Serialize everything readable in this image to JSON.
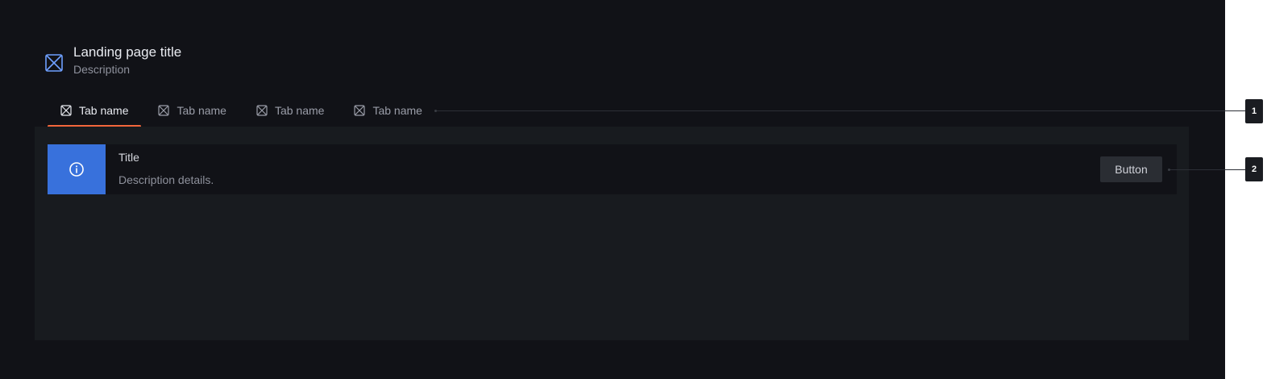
{
  "page": {
    "title": "Landing page title",
    "description": "Description",
    "icon": "placeholder-icon"
  },
  "tabs": [
    {
      "label": "Tab name",
      "icon": "placeholder-icon",
      "active": true
    },
    {
      "label": "Tab name",
      "icon": "placeholder-icon",
      "active": false
    },
    {
      "label": "Tab name",
      "icon": "placeholder-icon",
      "active": false
    },
    {
      "label": "Tab name",
      "icon": "placeholder-icon",
      "active": false
    }
  ],
  "alert": {
    "icon": "info-icon",
    "title": "Title",
    "description": "Description details.",
    "button_label": "Button"
  },
  "annotations": [
    "1",
    "2"
  ],
  "colors": {
    "background": "#111217",
    "panel": "#181b1f",
    "accent_tab": "#f2663b",
    "info": "#3871dc",
    "icon_blue": "#6e9fff"
  }
}
